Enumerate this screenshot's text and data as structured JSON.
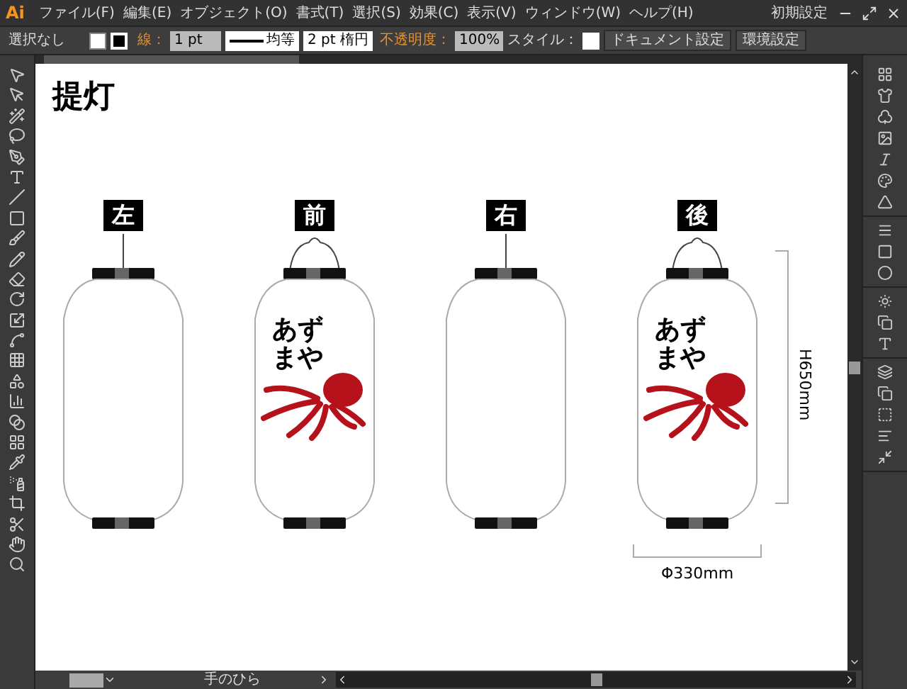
{
  "app": {
    "logo": "Ai",
    "menu": [
      "ファイル(F)",
      "編集(E)",
      "オブジェクト(O)",
      "書式(T)",
      "選択(S)",
      "効果(C)",
      "表示(V)",
      "ウィンドウ(W)",
      "ヘルプ(H)"
    ],
    "workspace": "初期設定"
  },
  "control_bar": {
    "selection": "選択なし",
    "stroke_label": "線：",
    "stroke_weight": "1 pt",
    "stroke_profile": "均等",
    "brush": "2 pt 楕円",
    "opacity_label": "不透明度：",
    "opacity": "100%",
    "style_label": "スタイル：",
    "buttons": [
      "ドキュメント設定",
      "環境設定"
    ]
  },
  "artboard": {
    "title": "提灯",
    "lanterns": [
      {
        "label": "左",
        "kind": "side"
      },
      {
        "label": "前",
        "kind": "face",
        "logo_text": "あずまや"
      },
      {
        "label": "右",
        "kind": "side"
      },
      {
        "label": "後",
        "kind": "face",
        "logo_text": "あずまや"
      }
    ],
    "height_dimension": "H650mm",
    "width_dimension": "Φ330mm"
  },
  "status_bar": {
    "tool": "手のひら"
  }
}
